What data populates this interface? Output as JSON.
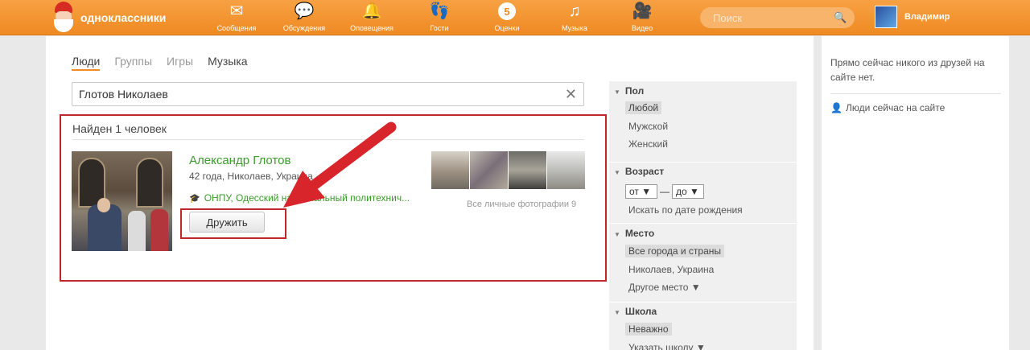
{
  "topbar": {
    "logo_text": "одноклассники",
    "nav": [
      {
        "label": "Сообщения",
        "icon": "envelope-icon",
        "glyph": "✉"
      },
      {
        "label": "Обсуждения",
        "icon": "chat-bubbles-icon",
        "glyph": "💬"
      },
      {
        "label": "Оповещения",
        "icon": "bell-icon",
        "glyph": "🔔"
      },
      {
        "label": "Гости",
        "icon": "footprints-icon",
        "glyph": "👣"
      },
      {
        "label": "Оценки",
        "icon": "rating-icon",
        "glyph": "5"
      },
      {
        "label": "Музыка",
        "icon": "music-note-icon",
        "glyph": "♫"
      },
      {
        "label": "Видео",
        "icon": "video-camera-icon",
        "glyph": "🎥"
      }
    ],
    "search_placeholder": "Поиск",
    "user_name": "Владимир"
  },
  "tabs": [
    "Люди",
    "Группы",
    "Игры",
    "Музыка"
  ],
  "search_query": "Глотов Николаев",
  "results": {
    "found_label": "Найден 1 человек",
    "person": {
      "name": "Александр Глотов",
      "meta": "42 года, Николаев, Украина",
      "school": "ОНПУ, Одесский национальный политехнич...",
      "friend_button": "Дружить",
      "all_photos": "Все личные фотографии 9"
    }
  },
  "filters": {
    "gender": {
      "title": "Пол",
      "options": [
        "Любой",
        "Мужской",
        "Женский"
      ],
      "selected": "Любой"
    },
    "age": {
      "title": "Возраст",
      "from": "от",
      "to": "до",
      "birth_link": "Искать по дате рождения"
    },
    "place": {
      "title": "Место",
      "options": [
        "Все города и страны",
        "Николаев, Украина",
        "Другое место ▼"
      ],
      "selected": "Все города и страны"
    },
    "school": {
      "title": "Школа",
      "options": [
        "Неважно",
        "Указать школу ▼"
      ],
      "selected": "Неважно"
    }
  },
  "side": {
    "online_text": "Прямо сейчас никого из друзей на сайте нет.",
    "online_link": "Люди сейчас на сайте"
  },
  "colors": {
    "brand": "#f08a24",
    "highlight": "#c0272d",
    "name_green": "#3a9d2a"
  }
}
